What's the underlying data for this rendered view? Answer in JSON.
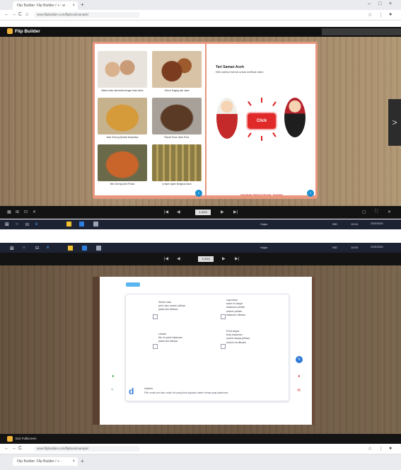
{
  "shot1": {
    "tab_title": "Flip Builder: Flip Builder / + - w",
    "tab_close": "×",
    "new_tab": "+",
    "window_controls": [
      "–",
      "□",
      "×"
    ],
    "nav_icons": [
      "←",
      "→",
      "C",
      "⌂"
    ],
    "url": "www.flipbuilder.com/flipbook/sample/",
    "right_icons": [
      "☆",
      "⋮",
      "●"
    ],
    "app_logo": "Flip Builder",
    "right_page": {
      "title": "Tari Saman Aceh",
      "subtitle": "Klik tombol merah untuk melihat video",
      "button": "Click",
      "footer": "Kebudayaan Nasional Indonesia - Nusantara",
      "page_number": "2"
    },
    "left_page": {
      "page_number": "1",
      "captions": [
        "Bakso khas Indonesia dengan kuah kaldu",
        "Semur Daging dari Jawa",
        "Nasi Goreng Spesial Nusantara",
        "Rawon Khas Jawa Timur",
        "Mie Goreng Aceh Pedas",
        "Lemper Ayam Bungkus Daun"
      ]
    },
    "next_arrow": ">",
    "toolbar_icons": [
      "▦",
      "⊞",
      "⊡",
      "✕"
    ],
    "toolbar_center": [
      "|◀",
      "◀",
      "▶",
      "▶|"
    ],
    "page_indicator": "1-2/24",
    "toolbar_right": [
      "▢",
      "⛶",
      "✕"
    ],
    "taskbar": {
      "start": "⊞",
      "left_icons": [
        "○",
        "⊟",
        "e",
        "▣",
        "✦"
      ],
      "weather": "Hujan",
      "lang": "IND",
      "clock": "10:04",
      "date": "22/02/2024"
    }
  },
  "shot2": {
    "taskbar": {
      "left_icons": [
        "⊞",
        "○",
        "⊟",
        "e",
        "▣",
        "✦"
      ],
      "weather": "Hujan",
      "lang": "IND",
      "clock": "10:05",
      "date": "22/02/2024"
    },
    "toolbar_center": [
      "|◀",
      "◀",
      "▶",
      "▶|"
    ],
    "page_indicator": "1-2/24",
    "modal": {
      "options": [
        "Select dan\nprint dan unduh pilihan\npada sisi dibuka",
        "Laporkan\nkami ini lanjut\nhalaman printer\nunduh printer\nhalaman dibuka",
        "Unduh\nfile ini print halaman\npada sisi dibuka",
        "Print tanpa\nbisa halaman\nunduh tanpa pilihan\nunduh ini dibuka"
      ],
      "footer_logo": "d",
      "footer_title": "Unduh",
      "footer_desc": "Pilih mode print dan unduh file yang Anda inginkan dalam format yang diperlukan",
      "right_buttons": [
        "✎",
        "●",
        "✉"
      ],
      "left_icons": [
        "●",
        "≈"
      ]
    },
    "fullscreen_label": "Exit Fullscreen",
    "chrome": {
      "nav_icons": [
        "←",
        "→",
        "C"
      ],
      "url": "www.flipbuilder.com/flipbook/sample/",
      "right_icons": [
        "☆",
        "⋮",
        "●"
      ],
      "tab_title": "Flip Builder: Flip Builder / + -",
      "tab_close": "×",
      "new_tab": "+"
    }
  },
  "colors": {
    "book_edge": "#e9967f",
    "accent_red": "#e02a2a",
    "accent_blue": "#2f7ad8",
    "taskbar": "#1d2333"
  }
}
